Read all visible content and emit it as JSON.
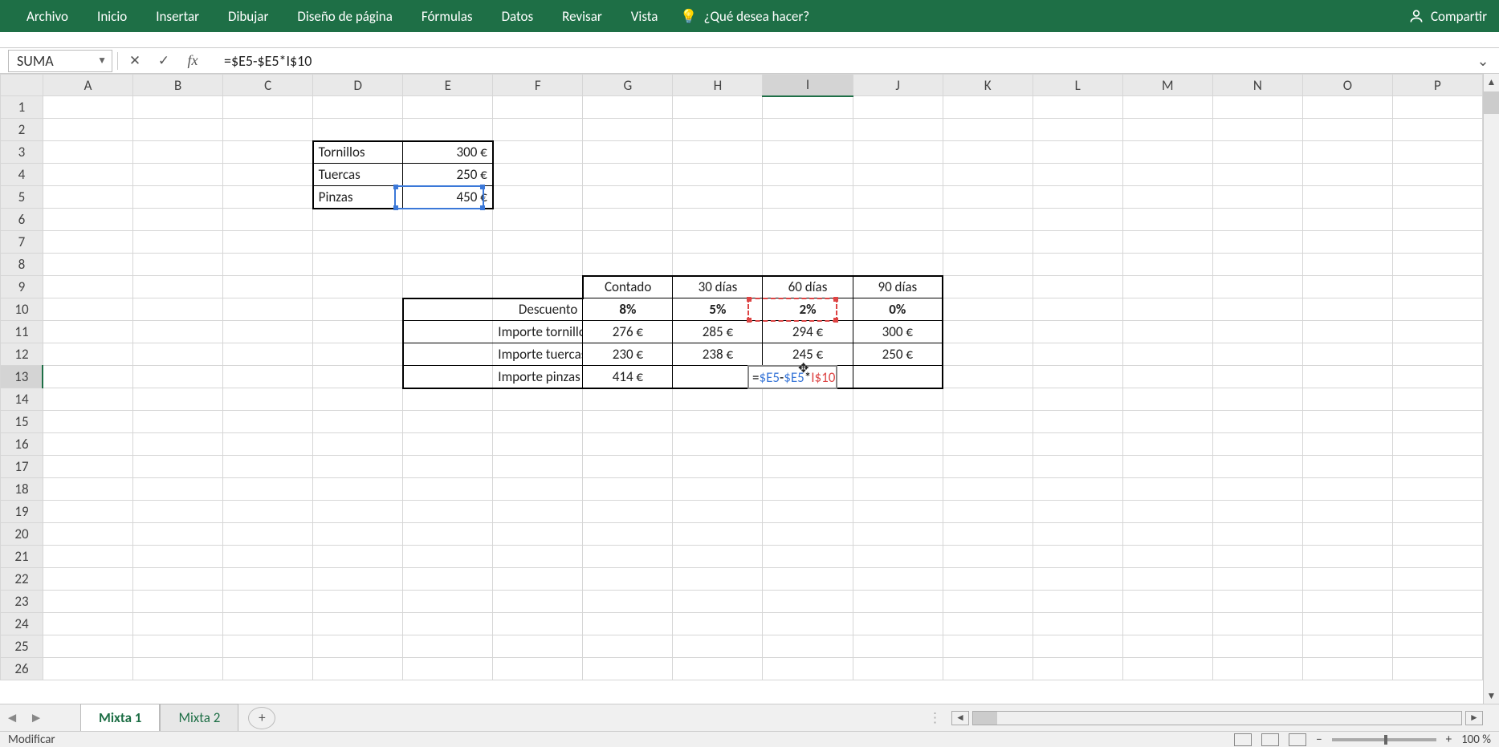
{
  "ribbon": {
    "tabs": [
      "Archivo",
      "Inicio",
      "Insertar",
      "Dibujar",
      "Diseño de página",
      "Fórmulas",
      "Datos",
      "Revisar",
      "Vista"
    ],
    "tellme": "¿Qué desea hacer?",
    "share": "Compartir"
  },
  "formula": {
    "namebox": "SUMA",
    "value": "=$E5-$E5*I$10"
  },
  "columns": [
    "A",
    "B",
    "C",
    "D",
    "E",
    "F",
    "G",
    "H",
    "I",
    "J",
    "K",
    "L",
    "M",
    "N",
    "O",
    "P"
  ],
  "rows": 26,
  "active_cell": "I13",
  "items_table": {
    "rows": [
      {
        "label": "Tornillos",
        "value": "300 €"
      },
      {
        "label": "Tuercas",
        "value": "250 €"
      },
      {
        "label": "Pinzas",
        "value": "450 €"
      }
    ]
  },
  "discount_table": {
    "headers": [
      "Contado",
      "30 días",
      "60 días",
      "90 días"
    ],
    "discount_label": "Descuento",
    "discounts": [
      "8%",
      "5%",
      "2%",
      "0%"
    ],
    "rows": [
      {
        "label": "Importe tornillos",
        "values": [
          "276 €",
          "285 €",
          "294 €",
          "300 €"
        ]
      },
      {
        "label": "Importe tuercas",
        "values": [
          "230 €",
          "238 €",
          "245 €",
          "250 €"
        ]
      },
      {
        "label": "Importe pinzas",
        "values": [
          "414 €",
          "",
          "",
          ""
        ]
      }
    ]
  },
  "editing_cell": {
    "parts": [
      "=",
      "$E5",
      "-",
      "$E5",
      "*",
      "I$10"
    ]
  },
  "sheets": {
    "active": "Mixta 1",
    "tabs": [
      "Mixta 1",
      "Mixta 2"
    ]
  },
  "status": {
    "mode": "Modificar",
    "zoom": "100 %"
  }
}
